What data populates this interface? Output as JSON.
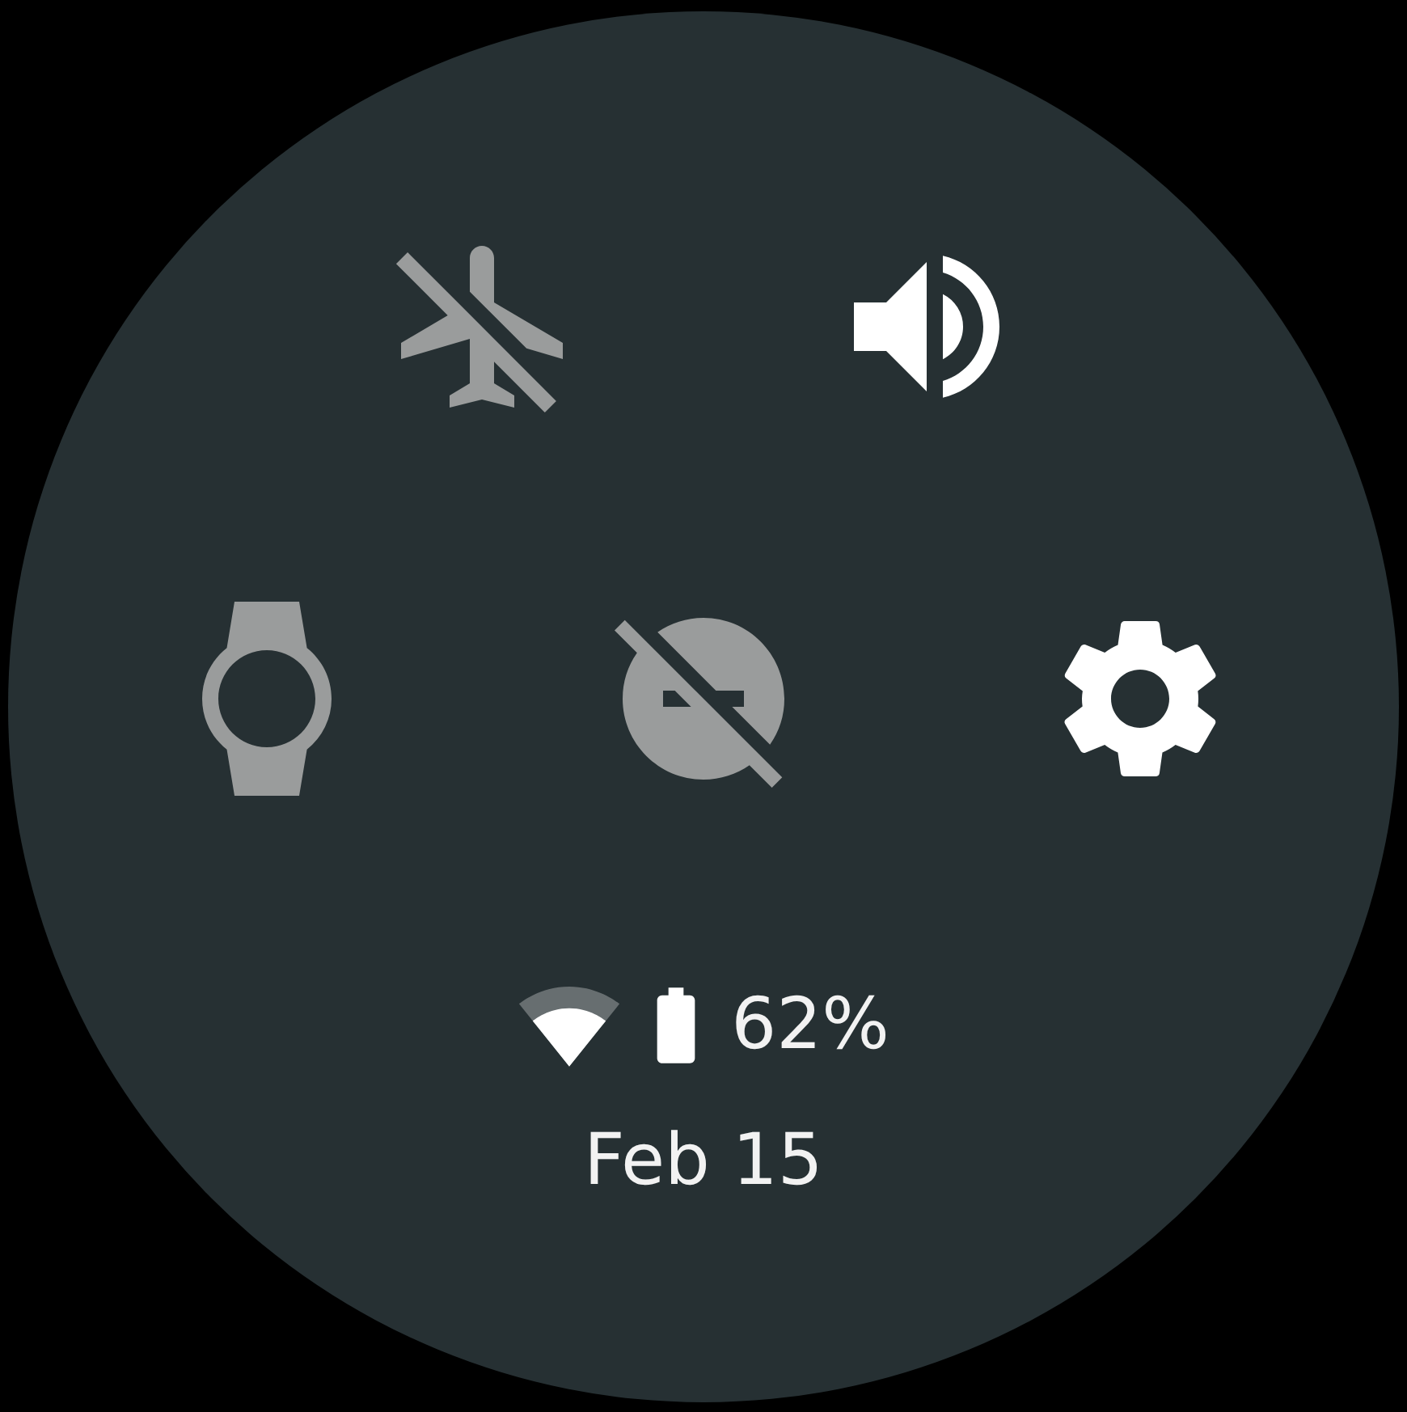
{
  "quick_settings": [
    {
      "kind": "airplane",
      "on": false
    },
    {
      "kind": "sound",
      "on": true
    }
  ],
  "quick_settings_row_2": [
    {
      "kind": "theater",
      "on": false
    },
    {
      "kind": "dnd",
      "on": false
    },
    {
      "kind": "settings",
      "on": true
    }
  ],
  "status": {
    "battery": "62%",
    "date": "Feb 15"
  }
}
